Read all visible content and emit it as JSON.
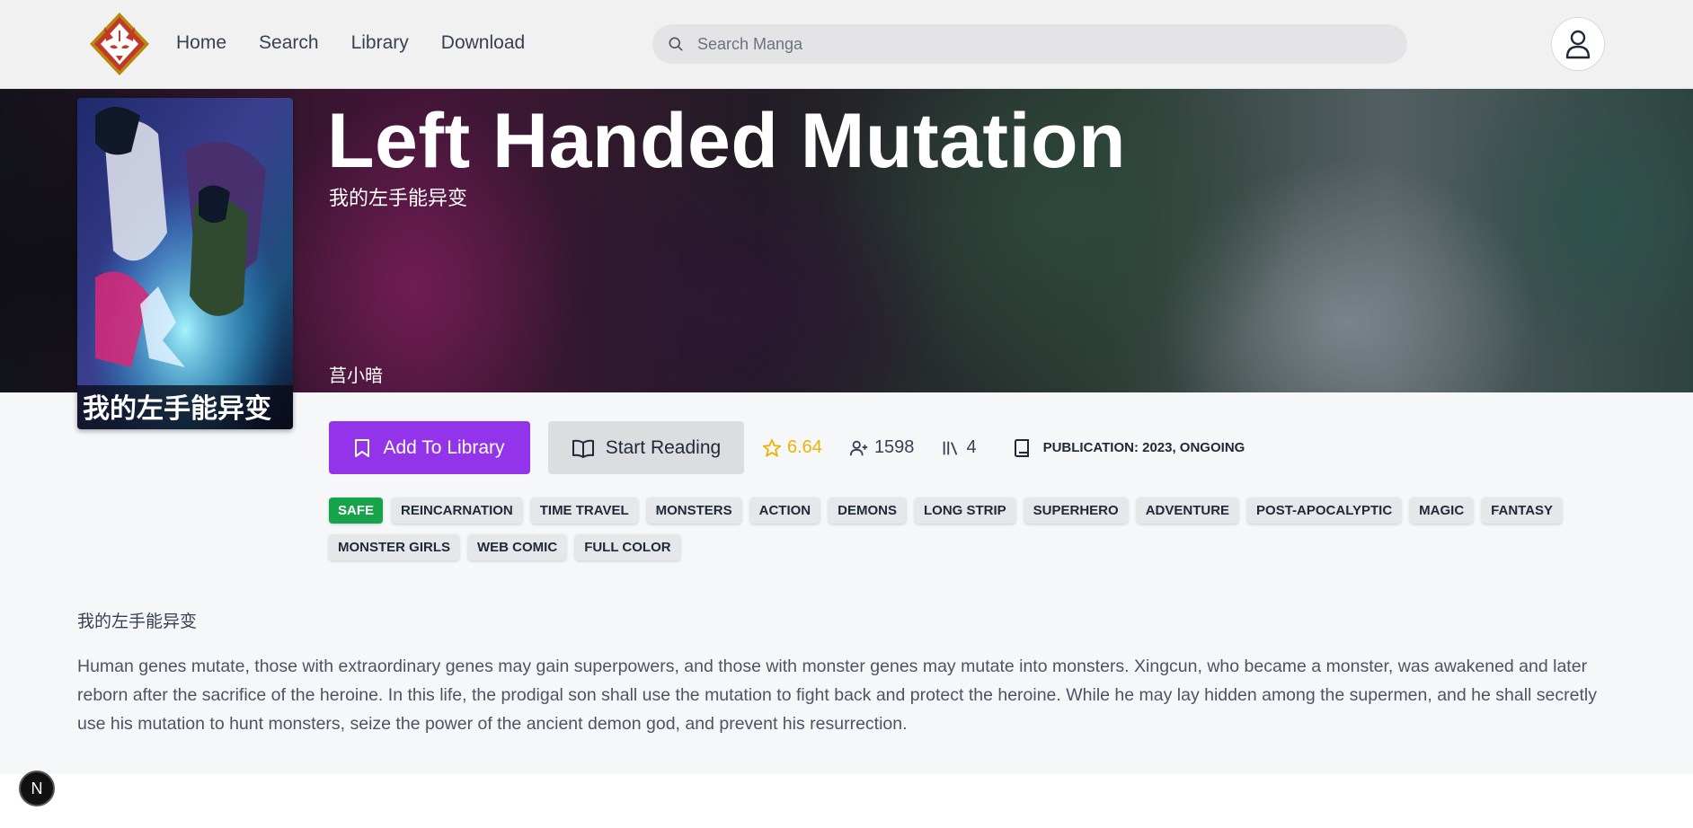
{
  "nav": {
    "links": [
      "Home",
      "Search",
      "Library",
      "Download"
    ]
  },
  "search": {
    "placeholder": "Search Manga"
  },
  "manga": {
    "title": "Left Handed Mutation",
    "alt_title": "我的左手能异变",
    "author": "莒小暗",
    "cover_text": "我的左手能异变",
    "rating": "6.64",
    "follows": "1598",
    "comments": "4",
    "publication": "PUBLICATION: 2023, ONGOING",
    "content_rating": "SAFE",
    "tags": [
      "REINCARNATION",
      "TIME TRAVEL",
      "MONSTERS",
      "ACTION",
      "DEMONS",
      "LONG STRIP",
      "SUPERHERO",
      "ADVENTURE",
      "POST-APOCALYPTIC",
      "MAGIC",
      "FANTASY",
      "MONSTER GIRLS",
      "WEB COMIC",
      "FULL COLOR"
    ],
    "description_alt": "我的左手能异变",
    "description": "Human genes mutate, those with extraordinary genes may gain superpowers, and those with monster genes may mutate into monsters. Xingcun, who became a monster, was awakened and later reborn after the sacrifice of the heroine. In this life, the prodigal son shall use the mutation to fight back and protect the heroine. While he may lay hidden among the supermen, and he shall secretly use his mutation to hunt monsters, seize the power of the ancient demon god, and prevent his resurrection."
  },
  "actions": {
    "add_label": "Add To Library",
    "read_label": "Start Reading"
  },
  "badge": {
    "letter": "N"
  },
  "colors": {
    "accent": "#9333ea",
    "safe": "#16a34a",
    "rating": "#eab308"
  },
  "icons": {
    "logo": "fox-mask-logo",
    "search": "search-icon",
    "user": "user-icon",
    "bookmark": "bookmark-icon",
    "book_open": "book-open-icon",
    "star": "star-icon",
    "follows": "user-plus-icon",
    "library": "library-icon",
    "publication": "book-icon"
  }
}
